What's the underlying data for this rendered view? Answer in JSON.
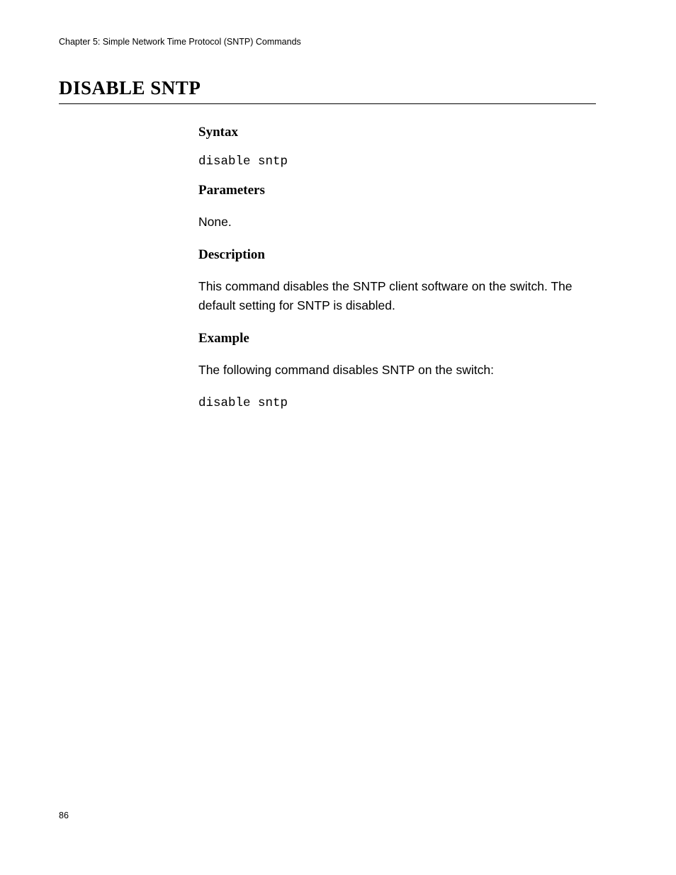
{
  "header": {
    "chapter_text": "Chapter 5: Simple Network Time Protocol (SNTP) Commands"
  },
  "title": "DISABLE SNTP",
  "sections": {
    "syntax": {
      "heading": "Syntax",
      "code": "disable sntp"
    },
    "parameters": {
      "heading": "Parameters",
      "text": "None."
    },
    "description": {
      "heading": "Description",
      "text": "This command disables the SNTP client software on the switch. The default setting for SNTP is disabled."
    },
    "example": {
      "heading": "Example",
      "intro": "The following command disables SNTP on the switch:",
      "code": "disable sntp"
    }
  },
  "footer": {
    "page_number": "86"
  }
}
